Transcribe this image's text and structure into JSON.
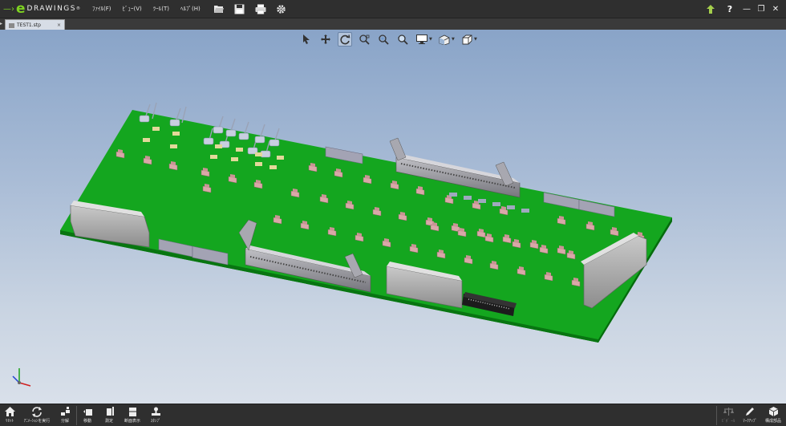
{
  "app": {
    "brand_letter": "e",
    "brand_text": "DRAWINGS",
    "brand_mark": "®"
  },
  "menu": [
    {
      "id": "file",
      "label": "ﾌｧｲﾙ(F)"
    },
    {
      "id": "view",
      "label": "ﾋﾞｭｰ(V)"
    },
    {
      "id": "tools",
      "label": "ﾂｰﾙ(T)"
    },
    {
      "id": "help",
      "label": "ﾍﾙﾌﾟ(H)"
    }
  ],
  "toolbar_icons": [
    "open-icon",
    "save-icon",
    "print-icon",
    "settings-icon"
  ],
  "right_icons": [
    "upgrade-arrow-icon",
    "help-icon"
  ],
  "window_controls": {
    "minimize": "—",
    "restore": "❐",
    "close": "✕"
  },
  "tab": {
    "name": "TEST1.stp",
    "close": "×"
  },
  "hud_tools": [
    {
      "name": "select-tool-icon",
      "active": false,
      "dropdown": false
    },
    {
      "name": "pan-tool-icon",
      "active": false,
      "dropdown": false
    },
    {
      "name": "rotate-tool-icon",
      "active": true,
      "dropdown": false
    },
    {
      "name": "zoom-fit-icon",
      "active": false,
      "dropdown": false
    },
    {
      "name": "zoom-icon",
      "active": false,
      "dropdown": false
    },
    {
      "name": "zoom-area-icon",
      "active": false,
      "dropdown": false
    },
    {
      "name": "display-style-icon",
      "active": false,
      "dropdown": true
    },
    {
      "name": "view-orientation-icon",
      "active": false,
      "dropdown": true
    },
    {
      "name": "3d-view-cube-icon",
      "active": false,
      "dropdown": true
    }
  ],
  "bottom_tools": [
    {
      "name": "reset",
      "icon": "home-icon",
      "label": "ﾘｾｯﾄ",
      "enabled": true
    },
    {
      "name": "animation",
      "icon": "animation-icon",
      "label": "ｱﾆﾒｰｼｮﾝを実行",
      "enabled": true
    },
    {
      "name": "explode",
      "icon": "explode-icon",
      "label": "分解",
      "enabled": true
    },
    {
      "name": "move",
      "icon": "move-icon",
      "label": "移動",
      "enabled": true
    },
    {
      "name": "measure",
      "icon": "measure-icon",
      "label": "測定",
      "enabled": true
    },
    {
      "name": "section",
      "icon": "section-icon",
      "label": "断面表示",
      "enabled": true
    },
    {
      "name": "stamp",
      "icon": "stamp-icon",
      "label": "ｽﾀﾝﾌﾟ",
      "enabled": true
    },
    {
      "name": "compare",
      "icon": "compare-icon",
      "label": "ﾋﾞﾎﾞ ｰﾙ",
      "enabled": false
    },
    {
      "name": "markup",
      "icon": "markup-icon",
      "label": "ﾏｰｸｱｯﾌﾟ",
      "enabled": true
    },
    {
      "name": "components",
      "icon": "components-icon",
      "label": "構成部品",
      "enabled": true
    }
  ],
  "colors": {
    "pcb": "#12a01a",
    "pcb_edge": "#0a6b10",
    "titlebar": "#2f2f2f",
    "accent": "#7ed321"
  }
}
